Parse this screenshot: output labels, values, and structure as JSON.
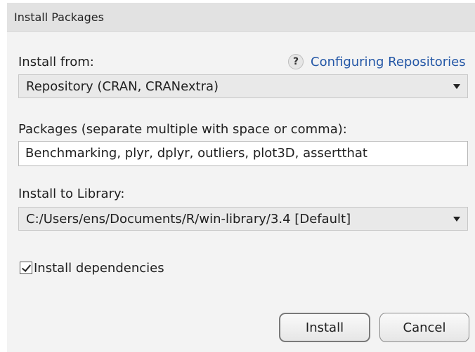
{
  "dialog": {
    "title": "Install Packages"
  },
  "install_from": {
    "label": "Install from:",
    "help_icon": "question-mark-icon",
    "help_link": "Configuring Repositories",
    "selected": "Repository (CRAN, CRANextra)"
  },
  "packages": {
    "label": "Packages (separate multiple with space or comma):",
    "value": "Benchmarking, plyr, dplyr, outliers, plot3D, assertthat"
  },
  "library": {
    "label": "Install to Library:",
    "selected": "C:/Users/ens/Documents/R/win-library/3.4 [Default]"
  },
  "dependencies": {
    "label": "Install dependencies",
    "checked": true
  },
  "buttons": {
    "install": "Install",
    "cancel": "Cancel"
  },
  "colors": {
    "link": "#2457a6",
    "titlebar": "#e2e2e2",
    "background": "#f3f3f3"
  }
}
